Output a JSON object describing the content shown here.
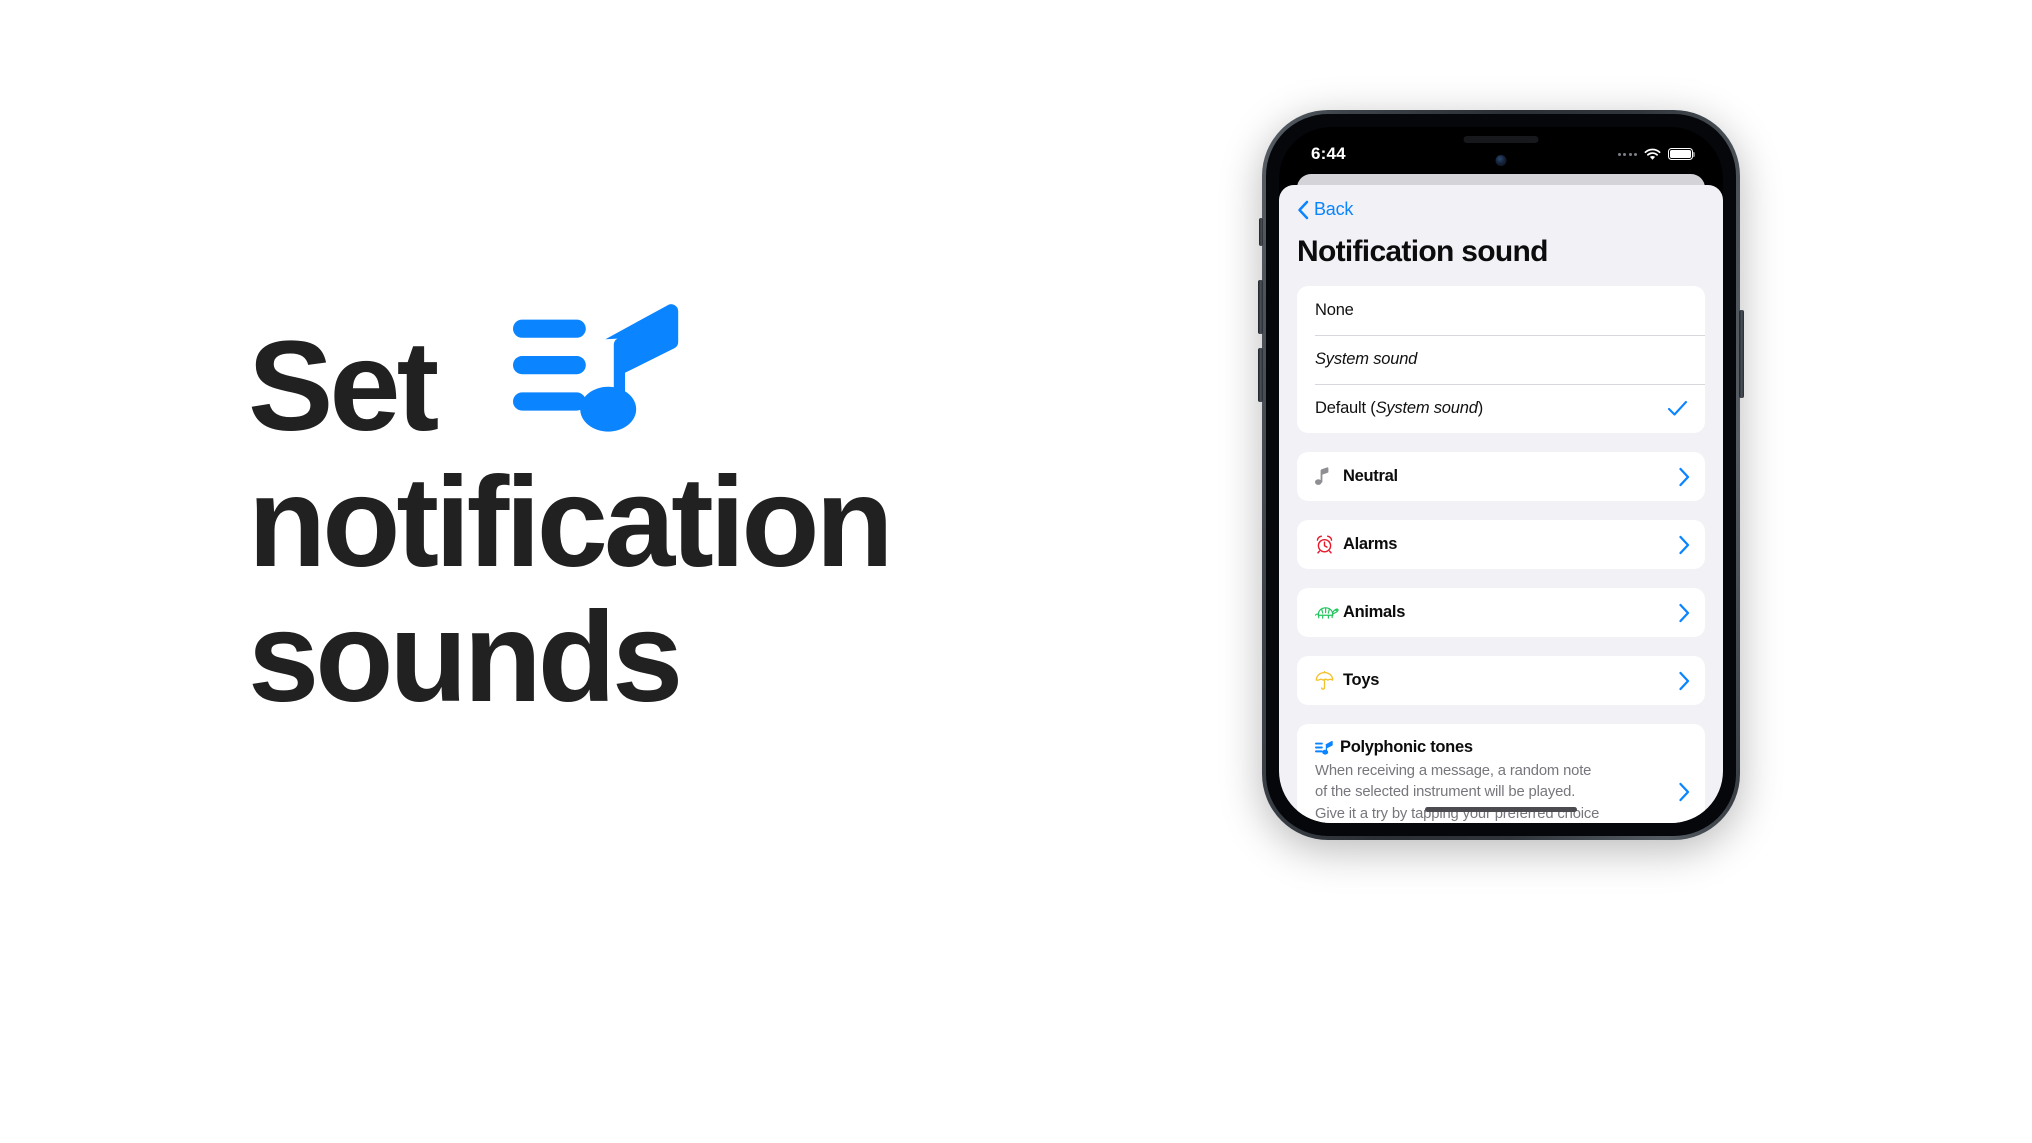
{
  "headline": {
    "line1": "Set",
    "line2": "notification",
    "line3": "sounds",
    "logo_icon": "playlist-music-note-icon",
    "color": "#212121",
    "accent": "#0a84ff"
  },
  "phone": {
    "status_bar": {
      "time": "6:44",
      "signal_icon": "cellular-signal-dots-icon",
      "wifi_icon": "wifi-icon",
      "battery_icon": "battery-full-icon"
    },
    "home_indicator": "home-indicator"
  },
  "sheet": {
    "back_label": "Back",
    "back_icon": "chevron-left-icon",
    "title": "Notification sound",
    "sound_options": [
      {
        "label": "None",
        "style": "regular",
        "checked": false
      },
      {
        "label": "System sound",
        "style": "italic",
        "checked": false
      },
      {
        "label": "Default (System sound)",
        "style": "mixed",
        "prefix": "Default (",
        "emphasis": "System sound",
        "suffix": ")",
        "checked": true
      }
    ],
    "check_icon": "checkmark-icon",
    "chevron_icon": "chevron-right-icon",
    "categories": [
      {
        "label": "Neutral",
        "icon": "music-note-icon",
        "icon_color": "#8e8e93"
      },
      {
        "label": "Alarms",
        "icon": "alarm-clock-icon",
        "icon_color": "#e8192c"
      },
      {
        "label": "Animals",
        "icon": "turtle-icon",
        "icon_color": "#22c55e"
      },
      {
        "label": "Toys",
        "icon": "umbrella-icon",
        "icon_color": "#f2c230"
      }
    ],
    "polyphonic": {
      "icon": "playlist-music-note-icon",
      "title": "Polyphonic tones",
      "description": "When receiving a message, a random note of the selected instrument will be played. Give it a try by tapping your preferred choice several times 😉."
    }
  },
  "colors": {
    "ios_blue": "#0a84ff",
    "sheet_bg": "#f1f1f6",
    "card_bg": "#ffffff",
    "separator": "#d8d8dc",
    "secondary_text": "#76767c"
  }
}
